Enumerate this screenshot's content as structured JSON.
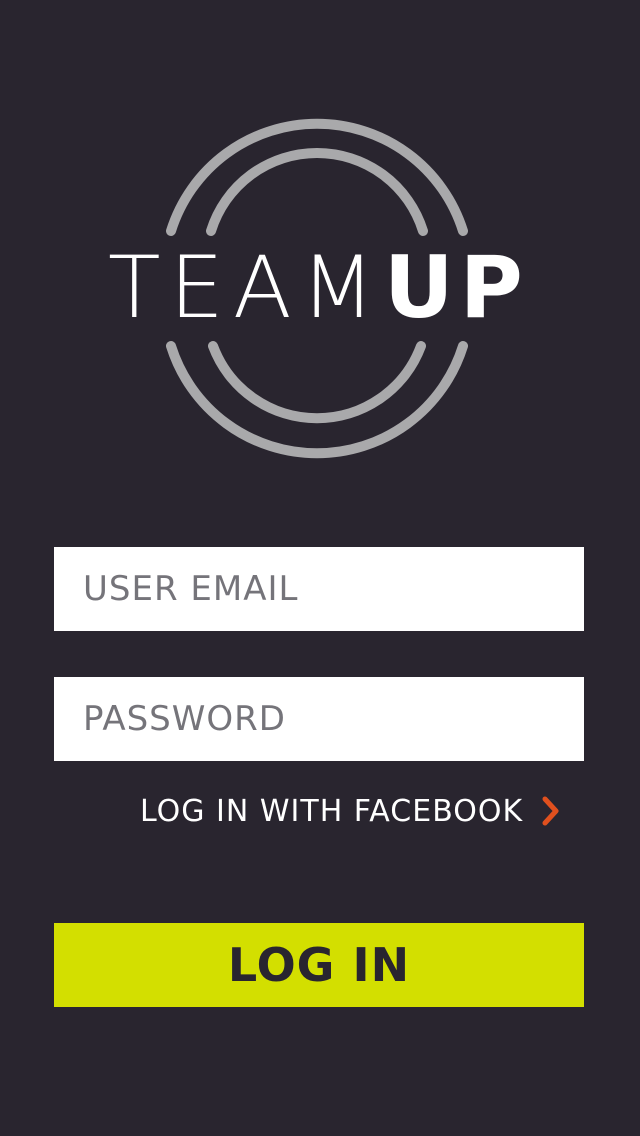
{
  "logo": {
    "text_thin": "TEAM",
    "text_bold": "UP"
  },
  "form": {
    "email_placeholder": "USER EMAIL",
    "password_placeholder": "PASSWORD",
    "facebook_link": "LOG IN WITH FACEBOOK",
    "facebook_icon": "chevron-right-icon",
    "login_button": "LOG IN"
  },
  "colors": {
    "background": "#29252f",
    "accent": "#d3df00",
    "chevron": "#e0501e",
    "ring": "#a9a9ab"
  }
}
